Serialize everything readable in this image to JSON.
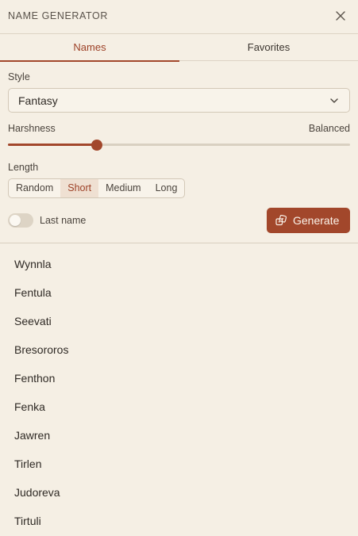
{
  "header": {
    "title": "NAME GENERATOR",
    "close_icon": "close-icon"
  },
  "tabs": [
    {
      "label": "Names",
      "active": true
    },
    {
      "label": "Favorites",
      "active": false
    }
  ],
  "style": {
    "label": "Style",
    "value": "Fantasy"
  },
  "harshness": {
    "label": "Harshness",
    "value_label": "Balanced",
    "fraction": 0.26
  },
  "length": {
    "label": "Length",
    "options": [
      "Random",
      "Short",
      "Medium",
      "Long"
    ],
    "selected": "Short"
  },
  "last_name": {
    "label": "Last name",
    "enabled": false
  },
  "generate": {
    "label": "Generate",
    "icon": "dice-icon"
  },
  "names": [
    "Wynnla",
    "Fentula",
    "Seevati",
    "Bresororos",
    "Fenthon",
    "Fenka",
    "Jawren",
    "Tirlen",
    "Judoreva",
    "Tirtuli"
  ],
  "colors": {
    "accent": "#a2472b",
    "background": "#f5efe4"
  }
}
